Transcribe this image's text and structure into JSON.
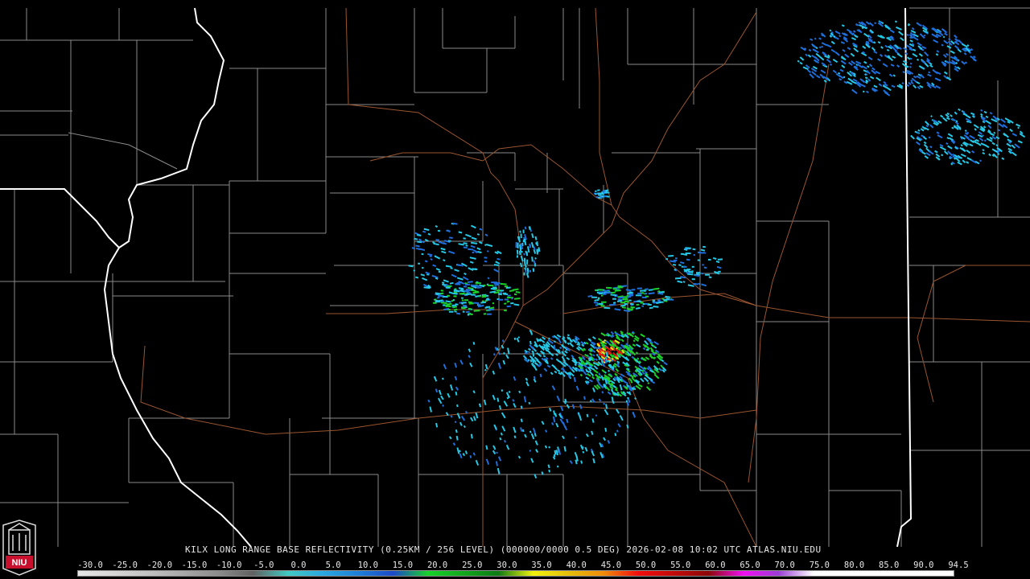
{
  "product": {
    "caption": "KILX LONG RANGE BASE REFLECTIVITY (0.25KM / 256 LEVEL) (000000/0000 0.5 DEG) 2026-02-08 10:02 UTC  ATLAS.NIU.EDU"
  },
  "logo": {
    "text": "NIU",
    "color": "#c8102e"
  },
  "scale": {
    "labels": [
      "-30.0",
      "-25.0",
      "-20.0",
      "-15.0",
      "-10.0",
      "-5.0",
      "0.0",
      "5.0",
      "10.0",
      "15.0",
      "20.0",
      "25.0",
      "30.0",
      "35.0",
      "40.0",
      "45.0",
      "50.0",
      "55.0",
      "60.0",
      "65.0",
      "70.0",
      "75.0",
      "80.0",
      "85.0",
      "90.0",
      "94.5"
    ],
    "colors": {
      "-30.0": "#e6e6e6",
      "-25.0": "#d6d6d6",
      "-20.0": "#c2c2c2",
      "-15.0": "#a8a8a8",
      "-10.0": "#8c8c8c",
      "-5.0": "#606060",
      "0.0": "#3fc9c2",
      "5.0": "#29a7e0",
      "10.0": "#1f7fd6",
      "15.0": "#1c49c8",
      "20.0": "#17d12a",
      "25.0": "#12a81d",
      "30.0": "#0d7a13",
      "35.0": "#f2f20d",
      "40.0": "#e5be0b",
      "45.0": "#f08b0a",
      "50.0": "#f20d0d",
      "55.0": "#c20a0a",
      "60.0": "#8c0707",
      "65.0": "#f20df2",
      "70.0": "#9b3cd6",
      "75.0": "#ffffff",
      "80.0": "#ffffff",
      "85.0": "#ffffff",
      "90.0": "#ffffff",
      "94.5": "#ffffff"
    }
  },
  "map_colors": {
    "background": "#000000",
    "county_lines": "#8a8a8a",
    "state_lines": "#ffffff",
    "highways": "#9a5530",
    "echo_light": "#25c8e6",
    "echo_mid": "#1e6fdc",
    "echo_green": "#1bd12a",
    "echo_yellow": "#f2e20d",
    "echo_red": "#e8150d"
  }
}
